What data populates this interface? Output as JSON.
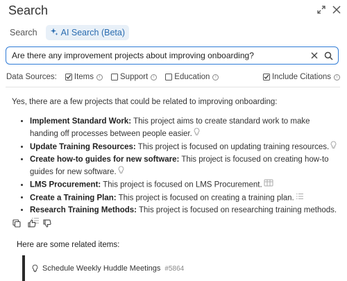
{
  "header": {
    "title": "Search"
  },
  "tabs": [
    {
      "label": "Search",
      "active": false
    },
    {
      "label": "AI Search (Beta)",
      "active": true
    }
  ],
  "search": {
    "query": "Are there any improvement projects about improving onboarding?"
  },
  "sources": {
    "label": "Data Sources:",
    "items": [
      {
        "label": "Items",
        "checked": true
      },
      {
        "label": "Support",
        "checked": false
      },
      {
        "label": "Education",
        "checked": false
      }
    ],
    "citations": {
      "label": "Include Citations",
      "checked": true
    }
  },
  "answer": {
    "intro": "Yes, there are a few projects that could be related to improving onboarding:",
    "items": [
      {
        "title": "Implement Standard Work:",
        "text": " This project aims to create standard work to make handing off processes between people easier.",
        "icon": "lightbulb-icon"
      },
      {
        "title": "Update Training Resources:",
        "text": " This project is focused on updating training resources.",
        "icon": "lightbulb-icon"
      },
      {
        "title": "Create how-to guides for new software:",
        "text": " This project is focused on creating how-to guides for new software.",
        "icon": "lightbulb-icon"
      },
      {
        "title": "LMS Procurement:",
        "text": " This project is focused on LMS Procurement.",
        "icon": "board-icon"
      },
      {
        "title": "Create a Training Plan:",
        "text": " This project is focused on creating a training plan.",
        "icon": "list-icon"
      },
      {
        "title": "Research Training Methods:",
        "text": " This project is focused on researching training methods.",
        "icon": "list-icon"
      }
    ]
  },
  "related": {
    "title": "Here are some related items:",
    "items": [
      {
        "label": "Schedule Weekly Huddle Meetings",
        "number": "#5864",
        "icon": "lightbulb-icon"
      }
    ]
  },
  "colors": {
    "accent": "#2f7bd6",
    "tab_bg": "#e8f0f8",
    "text": "#333333"
  }
}
